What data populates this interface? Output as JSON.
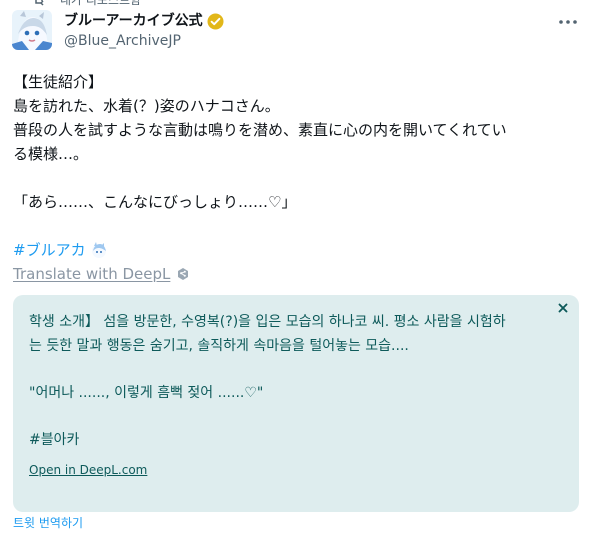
{
  "context": {
    "text": "내가 리포스트함"
  },
  "author": {
    "display_name": "ブルーアーカイブ公式",
    "handle": "@Blue_ArchiveJP",
    "avatar_icon": "avatar-icon",
    "verified_icon": "verified-badge-icon"
  },
  "tweet": {
    "lines": [
      "【生徒紹介】",
      "島を訪れた、水着(？)姿のハナコさん。",
      "普段の人を試すような言動は鳴りを潜め、素直に心の内を開いてくれてい",
      "る模様…。",
      "",
      "「あら……、こんなにびっしょり……♡」",
      ""
    ],
    "hashtag": "#ブルアカ",
    "hashtag_emoji": "blue-archive-hashtag-emoji-icon"
  },
  "translate": {
    "label": "Translate with DeepL",
    "icon": "deepl-logo-icon"
  },
  "translation": {
    "lines": [
      "학생 소개】 섬을 방문한, 수영복(?)을 입은 모습의 하나코 씨. 평소 사람을 시험하",
      "는 듯한 말과 행동은 숨기고, 솔직하게 속마음을 털어놓는 모습....",
      "",
      "\"어머나 ......, 이렇게 흠뻑 젖어 ......♡\"",
      "",
      "#블아카"
    ],
    "open_link": "Open in DeepL.com",
    "close_icon": "close-icon"
  },
  "footer": {
    "translate_post": "트윗 번역하기"
  },
  "colors": {
    "text": "#0f1419",
    "secondary": "#536471",
    "link": "#1d9bf0",
    "translation_bg": "#deedee",
    "translation_text": "#0d5a5a",
    "verified": "#e2b719"
  }
}
